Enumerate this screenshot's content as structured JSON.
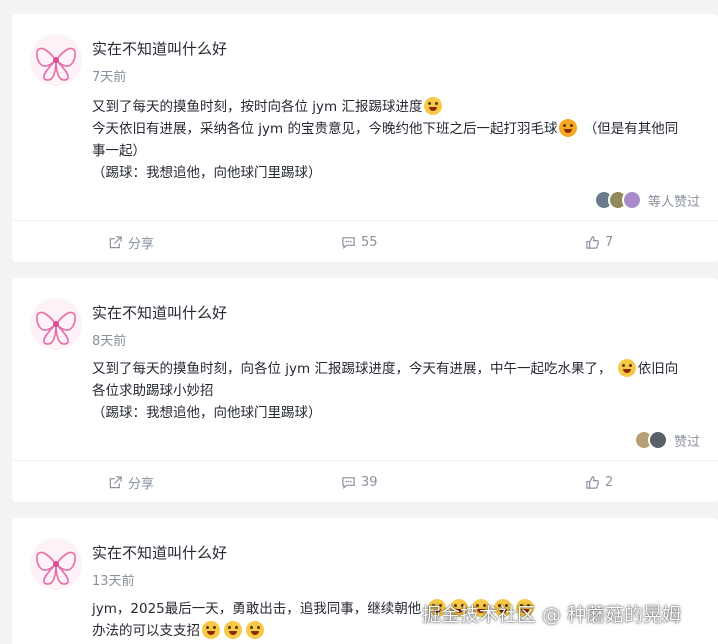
{
  "posts": [
    {
      "author": "实在不知道叫什么好",
      "time": "7天前",
      "lines": [
        "又到了每天的摸鱼时刻，按时向各位 jym 汇报踢球进度",
        "今天依旧有进展，采纳各位 jym 的宝贵意见，今晚约他下班之后一起打羽毛球",
        "（但是有其他同",
        "事一起）",
        "（踢球：我想追他，向他球门里踢球）"
      ],
      "likes_label": "等人赞过",
      "share_label": "分享",
      "comments": "55",
      "like_count": "7"
    },
    {
      "author": "实在不知道叫什么好",
      "time": "8天前",
      "lines": [
        "又到了每天的摸鱼时刻，向各位 jym 汇报踢球进度，今天有进展，中午一起吃水果了，",
        "依旧向",
        "各位求助踢球小妙招",
        "（踢球：我想追他，向他球门里踢球）"
      ],
      "likes_label": "赞过",
      "share_label": "分享",
      "comments": "39",
      "like_count": "2"
    },
    {
      "author": "实在不知道叫什么好",
      "time": "13天前",
      "lines": [
        "jym，2025最后一天，勇敢出击，追我同事，继续朝他",
        "办法的可以支支招"
      ]
    }
  ],
  "watermark": "掘金技术社区 @ 种蘑菇的晃姆",
  "colors": {
    "accent": "#1e80ff",
    "muted": "#8a919f",
    "text": "#252933",
    "background": "#f2f3f5"
  },
  "icons": [
    "avatar-image",
    "share-icon",
    "comment-icon",
    "thumbs-up-icon",
    "emoji"
  ]
}
